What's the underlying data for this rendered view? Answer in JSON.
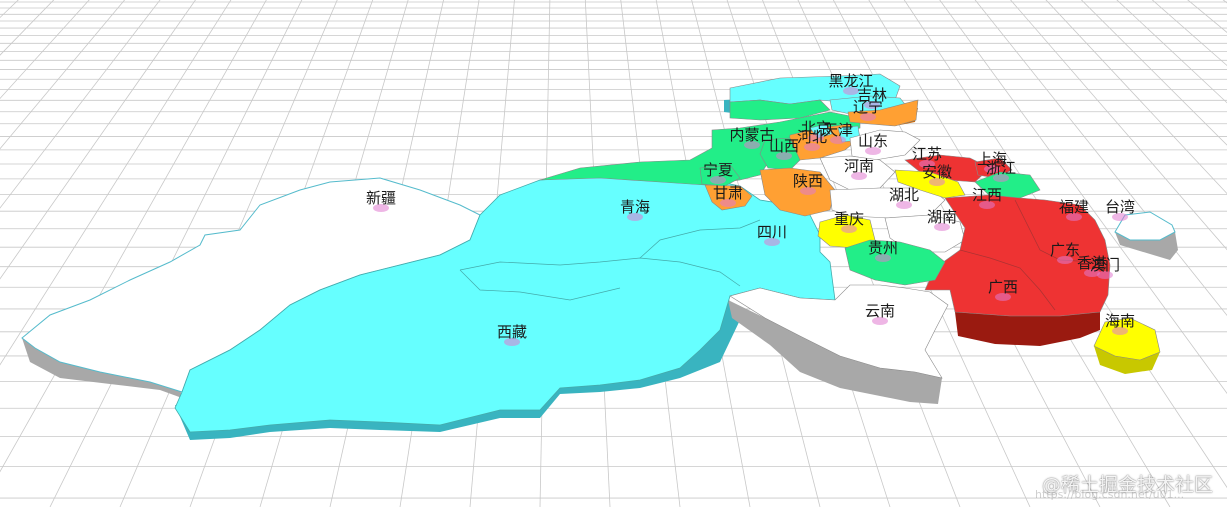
{
  "map": {
    "colors": {
      "white": "#ffffff",
      "cyan": "#66ffff",
      "green": "#22ee88",
      "orange": "#ffa033",
      "red": "#ee3333",
      "yellow": "#ffff00",
      "side_cyan": "#39b4c0",
      "side_white": "#a8a8a8",
      "side_red": "#9a1a10",
      "side_yellow": "#c8c800",
      "grid": "#c8c8c8"
    },
    "provinces": [
      {
        "name": "新疆",
        "color": "white"
      },
      {
        "name": "西藏",
        "color": "cyan"
      },
      {
        "name": "青海",
        "color": "cyan"
      },
      {
        "name": "四川",
        "color": "cyan"
      },
      {
        "name": "甘肃",
        "color": "orange"
      },
      {
        "name": "宁夏",
        "color": "green"
      },
      {
        "name": "内蒙古",
        "color": "green"
      },
      {
        "name": "黑龙江",
        "color": "cyan"
      },
      {
        "name": "吉林",
        "color": "cyan"
      },
      {
        "name": "辽宁",
        "color": "orange"
      },
      {
        "name": "北京",
        "color": "cyan"
      },
      {
        "name": "天津",
        "color": "cyan"
      },
      {
        "name": "河北",
        "color": "orange"
      },
      {
        "name": "山西",
        "color": "green"
      },
      {
        "name": "山东",
        "color": "white"
      },
      {
        "name": "河南",
        "color": "white"
      },
      {
        "name": "陕西",
        "color": "orange"
      },
      {
        "name": "江苏",
        "color": "red"
      },
      {
        "name": "安徽",
        "color": "yellow"
      },
      {
        "name": "上海",
        "color": "red"
      },
      {
        "name": "浙江",
        "color": "green"
      },
      {
        "name": "湖北",
        "color": "white"
      },
      {
        "name": "重庆",
        "color": "yellow"
      },
      {
        "name": "湖南",
        "color": "white"
      },
      {
        "name": "江西",
        "color": "red"
      },
      {
        "name": "福建",
        "color": "red"
      },
      {
        "name": "台湾",
        "color": "cyan"
      },
      {
        "name": "贵州",
        "color": "green"
      },
      {
        "name": "云南",
        "color": "white"
      },
      {
        "name": "广西",
        "color": "red"
      },
      {
        "name": "广东",
        "color": "red"
      },
      {
        "name": "香港",
        "color": "red"
      },
      {
        "name": "澳门",
        "color": "red"
      },
      {
        "name": "海南",
        "color": "yellow"
      }
    ]
  },
  "watermark": "@稀土掘金技术社区",
  "watermark_sub": "https://blog.csdn.net/u01..."
}
